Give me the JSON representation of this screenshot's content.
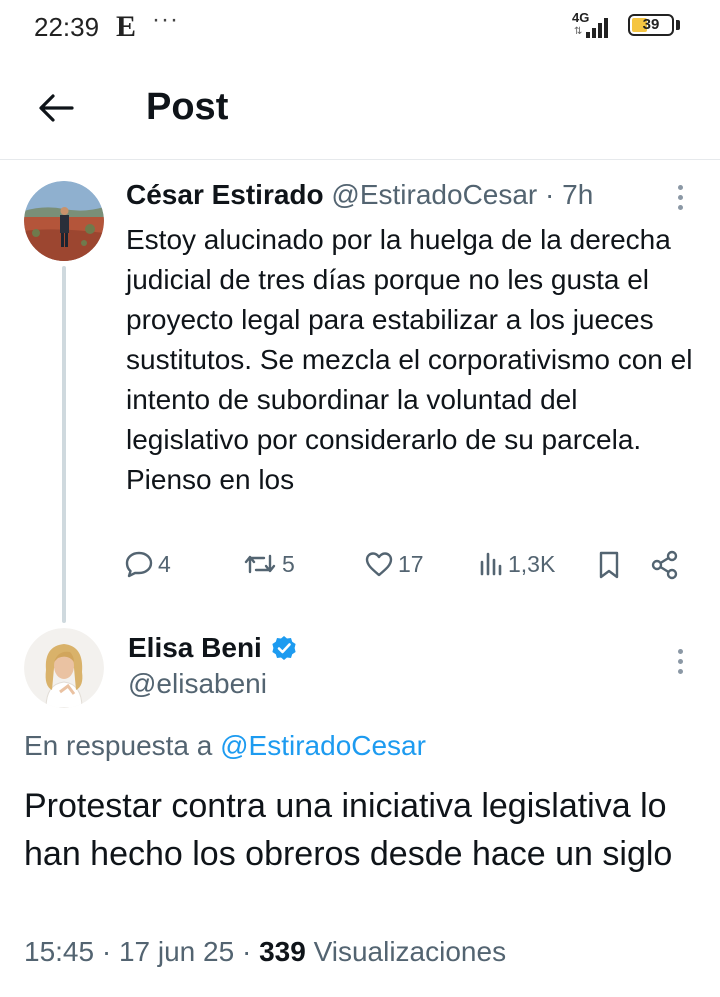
{
  "status_bar": {
    "time": "22:39",
    "app_icon_letter": "E",
    "more_dots": "···",
    "network": "4G",
    "battery": "39",
    "battery_level": 0.39,
    "battery_color": "#f5c542"
  },
  "header": {
    "title": "Post",
    "back_icon": "arrow-left-icon"
  },
  "parent_tweet": {
    "author_name": "César Estirado",
    "handle": "@EstiradoCesar",
    "separator": "·",
    "time": "7h",
    "text": "Estoy alucinado por la huelga de la derecha judicial de tres días porque no les gusta el proyecto legal para estabilizar a los jueces sustitutos. Se mezcla el corporativismo con el intento de subordinar la voluntad del legislativo por considerarlo de su parcela. Pienso en los",
    "actions": {
      "replies": "4",
      "retweets": "5",
      "likes": "17",
      "views": "1,3K"
    }
  },
  "reply_tweet": {
    "author_name": "Elisa Beni",
    "verified": true,
    "verified_color": "#1d9bf0",
    "handle": "@elisabeni",
    "reply_prefix": "En respuesta a",
    "reply_to": "@EstiradoCesar",
    "text": "Protestar contra una iniciativa legislativa lo han hecho los obreros desde hace un siglo",
    "time": "15:45",
    "separator": "·",
    "date": "17 jun 25",
    "views_count": "339",
    "views_label": "Visualizaciones"
  },
  "colors": {
    "text_primary": "#0f1419",
    "text_secondary": "#536471",
    "link": "#1d9bf0",
    "divider": "#e6e9ec"
  }
}
